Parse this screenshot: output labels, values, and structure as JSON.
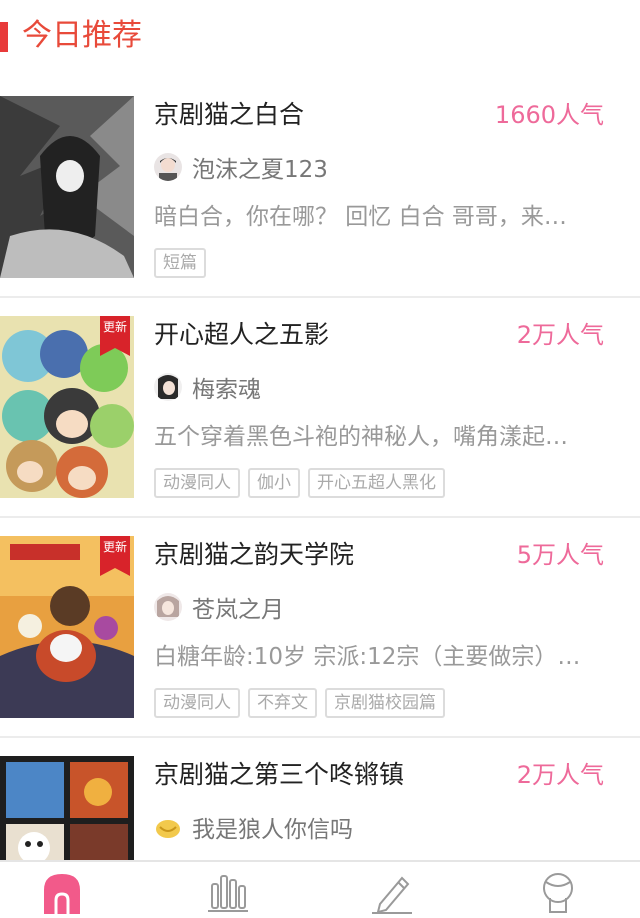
{
  "header": {
    "title": "今日推荐"
  },
  "items": [
    {
      "title": "京剧猫之白合",
      "popularity": "1660人气",
      "author": "泡沫之夏123",
      "description": "暗白合，你在哪？ 回忆 白合 哥哥，来…",
      "badge": "",
      "tags": [
        "短篇"
      ]
    },
    {
      "title": "开心超人之五影",
      "popularity": "2万人气",
      "author": "梅索魂",
      "description": "五个穿着黑色斗袍的神秘人，嘴角漾起…",
      "badge": "更新",
      "tags": [
        "动漫同人",
        "伽小",
        "开心五超人黑化"
      ]
    },
    {
      "title": "京剧猫之韵天学院",
      "popularity": "5万人气",
      "author": "苍岚之月",
      "description": "白糖年龄:10岁 宗派:12宗（主要做宗）…",
      "badge": "更新",
      "tags": [
        "动漫同人",
        "不弃文",
        "京剧猫校园篇"
      ]
    },
    {
      "title": "京剧猫之第三个咚锵镇",
      "popularity": "2万人气",
      "author": "我是狼人你信吗",
      "description": "",
      "badge": "",
      "tags": []
    }
  ],
  "tabbar": {
    "icons": [
      "home-arch-icon",
      "ranking-bars-icon",
      "pencil-write-icon",
      "profile-person-icon"
    ]
  },
  "colors": {
    "accent": "#e83a3a",
    "popularity": "#ee6a9a",
    "active_tab": "#f25a8a"
  }
}
